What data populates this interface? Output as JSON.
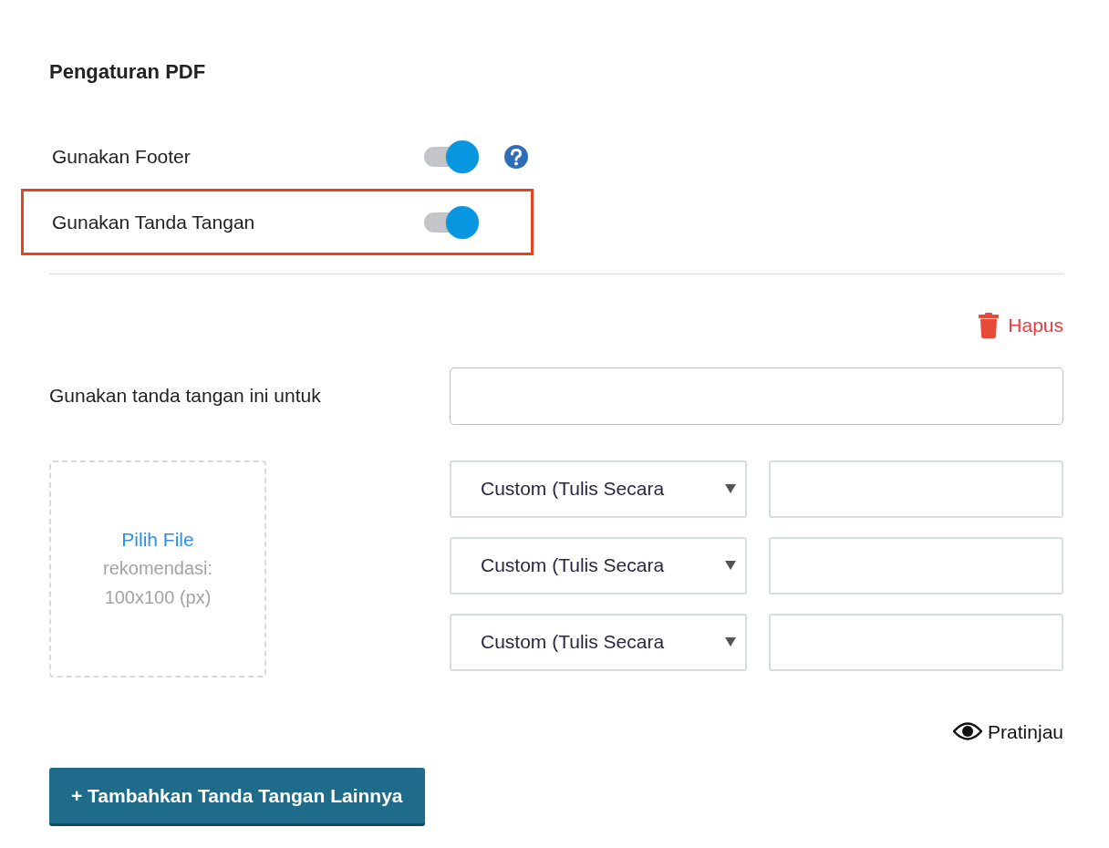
{
  "title": "Pengaturan PDF",
  "settings": [
    {
      "label": "Gunakan Footer",
      "on": true,
      "help": true,
      "highlighted": false
    },
    {
      "label": "Gunakan Tanda Tangan",
      "on": true,
      "help": false,
      "highlighted": true
    }
  ],
  "delete_label": "Hapus",
  "usage": {
    "label": "Gunakan tanda tangan ini untuk"
  },
  "upload": {
    "link": "Pilih File",
    "hint": "rekomendasi: 100x100 (px)"
  },
  "signers": [
    {
      "select": "Custom (Tulis Secara"
    },
    {
      "select": "Custom (Tulis Secara"
    },
    {
      "select": "Custom (Tulis Secara"
    }
  ],
  "preview_label": "Pratinjau",
  "add_button": "+ Tambahkan Tanda Tangan Lainnya"
}
